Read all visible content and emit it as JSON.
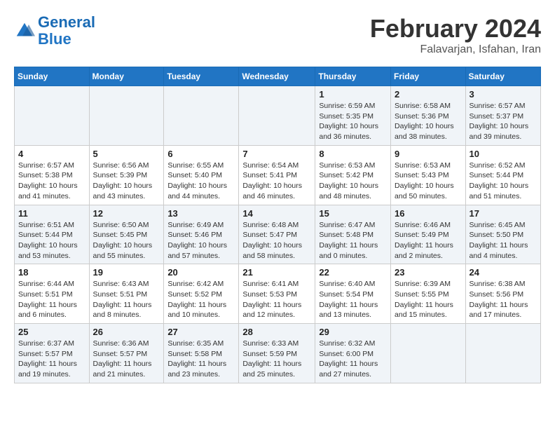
{
  "header": {
    "logo_line1": "General",
    "logo_line2": "Blue",
    "month_title": "February 2024",
    "location": "Falavarjan, Isfahan, Iran"
  },
  "days_of_week": [
    "Sunday",
    "Monday",
    "Tuesday",
    "Wednesday",
    "Thursday",
    "Friday",
    "Saturday"
  ],
  "weeks": [
    [
      {
        "day": "",
        "sunrise": "",
        "sunset": "",
        "daylight": ""
      },
      {
        "day": "",
        "sunrise": "",
        "sunset": "",
        "daylight": ""
      },
      {
        "day": "",
        "sunrise": "",
        "sunset": "",
        "daylight": ""
      },
      {
        "day": "",
        "sunrise": "",
        "sunset": "",
        "daylight": ""
      },
      {
        "day": "1",
        "sunrise": "6:59 AM",
        "sunset": "5:35 PM",
        "daylight": "10 hours and 36 minutes."
      },
      {
        "day": "2",
        "sunrise": "6:58 AM",
        "sunset": "5:36 PM",
        "daylight": "10 hours and 38 minutes."
      },
      {
        "day": "3",
        "sunrise": "6:57 AM",
        "sunset": "5:37 PM",
        "daylight": "10 hours and 39 minutes."
      }
    ],
    [
      {
        "day": "4",
        "sunrise": "6:57 AM",
        "sunset": "5:38 PM",
        "daylight": "10 hours and 41 minutes."
      },
      {
        "day": "5",
        "sunrise": "6:56 AM",
        "sunset": "5:39 PM",
        "daylight": "10 hours and 43 minutes."
      },
      {
        "day": "6",
        "sunrise": "6:55 AM",
        "sunset": "5:40 PM",
        "daylight": "10 hours and 44 minutes."
      },
      {
        "day": "7",
        "sunrise": "6:54 AM",
        "sunset": "5:41 PM",
        "daylight": "10 hours and 46 minutes."
      },
      {
        "day": "8",
        "sunrise": "6:53 AM",
        "sunset": "5:42 PM",
        "daylight": "10 hours and 48 minutes."
      },
      {
        "day": "9",
        "sunrise": "6:53 AM",
        "sunset": "5:43 PM",
        "daylight": "10 hours and 50 minutes."
      },
      {
        "day": "10",
        "sunrise": "6:52 AM",
        "sunset": "5:44 PM",
        "daylight": "10 hours and 51 minutes."
      }
    ],
    [
      {
        "day": "11",
        "sunrise": "6:51 AM",
        "sunset": "5:44 PM",
        "daylight": "10 hours and 53 minutes."
      },
      {
        "day": "12",
        "sunrise": "6:50 AM",
        "sunset": "5:45 PM",
        "daylight": "10 hours and 55 minutes."
      },
      {
        "day": "13",
        "sunrise": "6:49 AM",
        "sunset": "5:46 PM",
        "daylight": "10 hours and 57 minutes."
      },
      {
        "day": "14",
        "sunrise": "6:48 AM",
        "sunset": "5:47 PM",
        "daylight": "10 hours and 58 minutes."
      },
      {
        "day": "15",
        "sunrise": "6:47 AM",
        "sunset": "5:48 PM",
        "daylight": "11 hours and 0 minutes."
      },
      {
        "day": "16",
        "sunrise": "6:46 AM",
        "sunset": "5:49 PM",
        "daylight": "11 hours and 2 minutes."
      },
      {
        "day": "17",
        "sunrise": "6:45 AM",
        "sunset": "5:50 PM",
        "daylight": "11 hours and 4 minutes."
      }
    ],
    [
      {
        "day": "18",
        "sunrise": "6:44 AM",
        "sunset": "5:51 PM",
        "daylight": "11 hours and 6 minutes."
      },
      {
        "day": "19",
        "sunrise": "6:43 AM",
        "sunset": "5:51 PM",
        "daylight": "11 hours and 8 minutes."
      },
      {
        "day": "20",
        "sunrise": "6:42 AM",
        "sunset": "5:52 PM",
        "daylight": "11 hours and 10 minutes."
      },
      {
        "day": "21",
        "sunrise": "6:41 AM",
        "sunset": "5:53 PM",
        "daylight": "11 hours and 12 minutes."
      },
      {
        "day": "22",
        "sunrise": "6:40 AM",
        "sunset": "5:54 PM",
        "daylight": "11 hours and 13 minutes."
      },
      {
        "day": "23",
        "sunrise": "6:39 AM",
        "sunset": "5:55 PM",
        "daylight": "11 hours and 15 minutes."
      },
      {
        "day": "24",
        "sunrise": "6:38 AM",
        "sunset": "5:56 PM",
        "daylight": "11 hours and 17 minutes."
      }
    ],
    [
      {
        "day": "25",
        "sunrise": "6:37 AM",
        "sunset": "5:57 PM",
        "daylight": "11 hours and 19 minutes."
      },
      {
        "day": "26",
        "sunrise": "6:36 AM",
        "sunset": "5:57 PM",
        "daylight": "11 hours and 21 minutes."
      },
      {
        "day": "27",
        "sunrise": "6:35 AM",
        "sunset": "5:58 PM",
        "daylight": "11 hours and 23 minutes."
      },
      {
        "day": "28",
        "sunrise": "6:33 AM",
        "sunset": "5:59 PM",
        "daylight": "11 hours and 25 minutes."
      },
      {
        "day": "29",
        "sunrise": "6:32 AM",
        "sunset": "6:00 PM",
        "daylight": "11 hours and 27 minutes."
      },
      {
        "day": "",
        "sunrise": "",
        "sunset": "",
        "daylight": ""
      },
      {
        "day": "",
        "sunrise": "",
        "sunset": "",
        "daylight": ""
      }
    ]
  ],
  "labels": {
    "sunrise": "Sunrise:",
    "sunset": "Sunset:",
    "daylight": "Daylight:"
  }
}
